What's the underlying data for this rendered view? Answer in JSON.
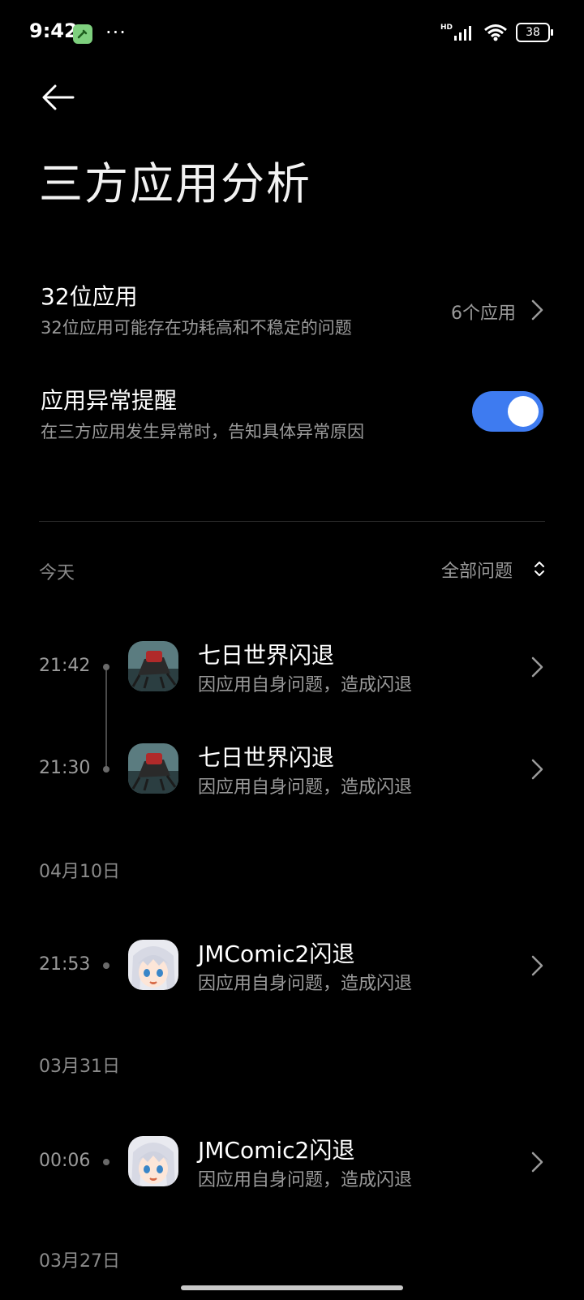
{
  "status_bar": {
    "time": "9:42",
    "more": "···",
    "network_label": "HD",
    "battery": "38"
  },
  "header": {
    "title": "三方应用分析"
  },
  "settings": {
    "bit32": {
      "title": "32位应用",
      "subtitle": "32位应用可能存在功耗高和不稳定的问题",
      "value": "6个应用"
    },
    "alert": {
      "title": "应用异常提醒",
      "subtitle": "在三方应用发生异常时，告知具体异常原因",
      "enabled": true
    }
  },
  "filter": {
    "label": "全部问题"
  },
  "sections": [
    {
      "date": "今天",
      "items": [
        {
          "time": "21:42",
          "title": "七日世界闪退",
          "subtitle": "因应用自身问题，造成闪退",
          "icon": "game-icon"
        },
        {
          "time": "21:30",
          "title": "七日世界闪退",
          "subtitle": "因应用自身问题，造成闪退",
          "icon": "game-icon"
        }
      ]
    },
    {
      "date": "04月10日",
      "items": [
        {
          "time": "21:53",
          "title": "JMComic2闪退",
          "subtitle": "因应用自身问题，造成闪退",
          "icon": "anime-avatar-icon"
        }
      ]
    },
    {
      "date": "03月31日",
      "items": [
        {
          "time": "00:06",
          "title": "JMComic2闪退",
          "subtitle": "因应用自身问题，造成闪退",
          "icon": "anime-avatar-icon"
        }
      ]
    },
    {
      "date": "03月27日",
      "items": []
    }
  ],
  "colors": {
    "background": "#000000",
    "accent": "#3e7bf0",
    "secondary_text": "#9a9a9a"
  }
}
